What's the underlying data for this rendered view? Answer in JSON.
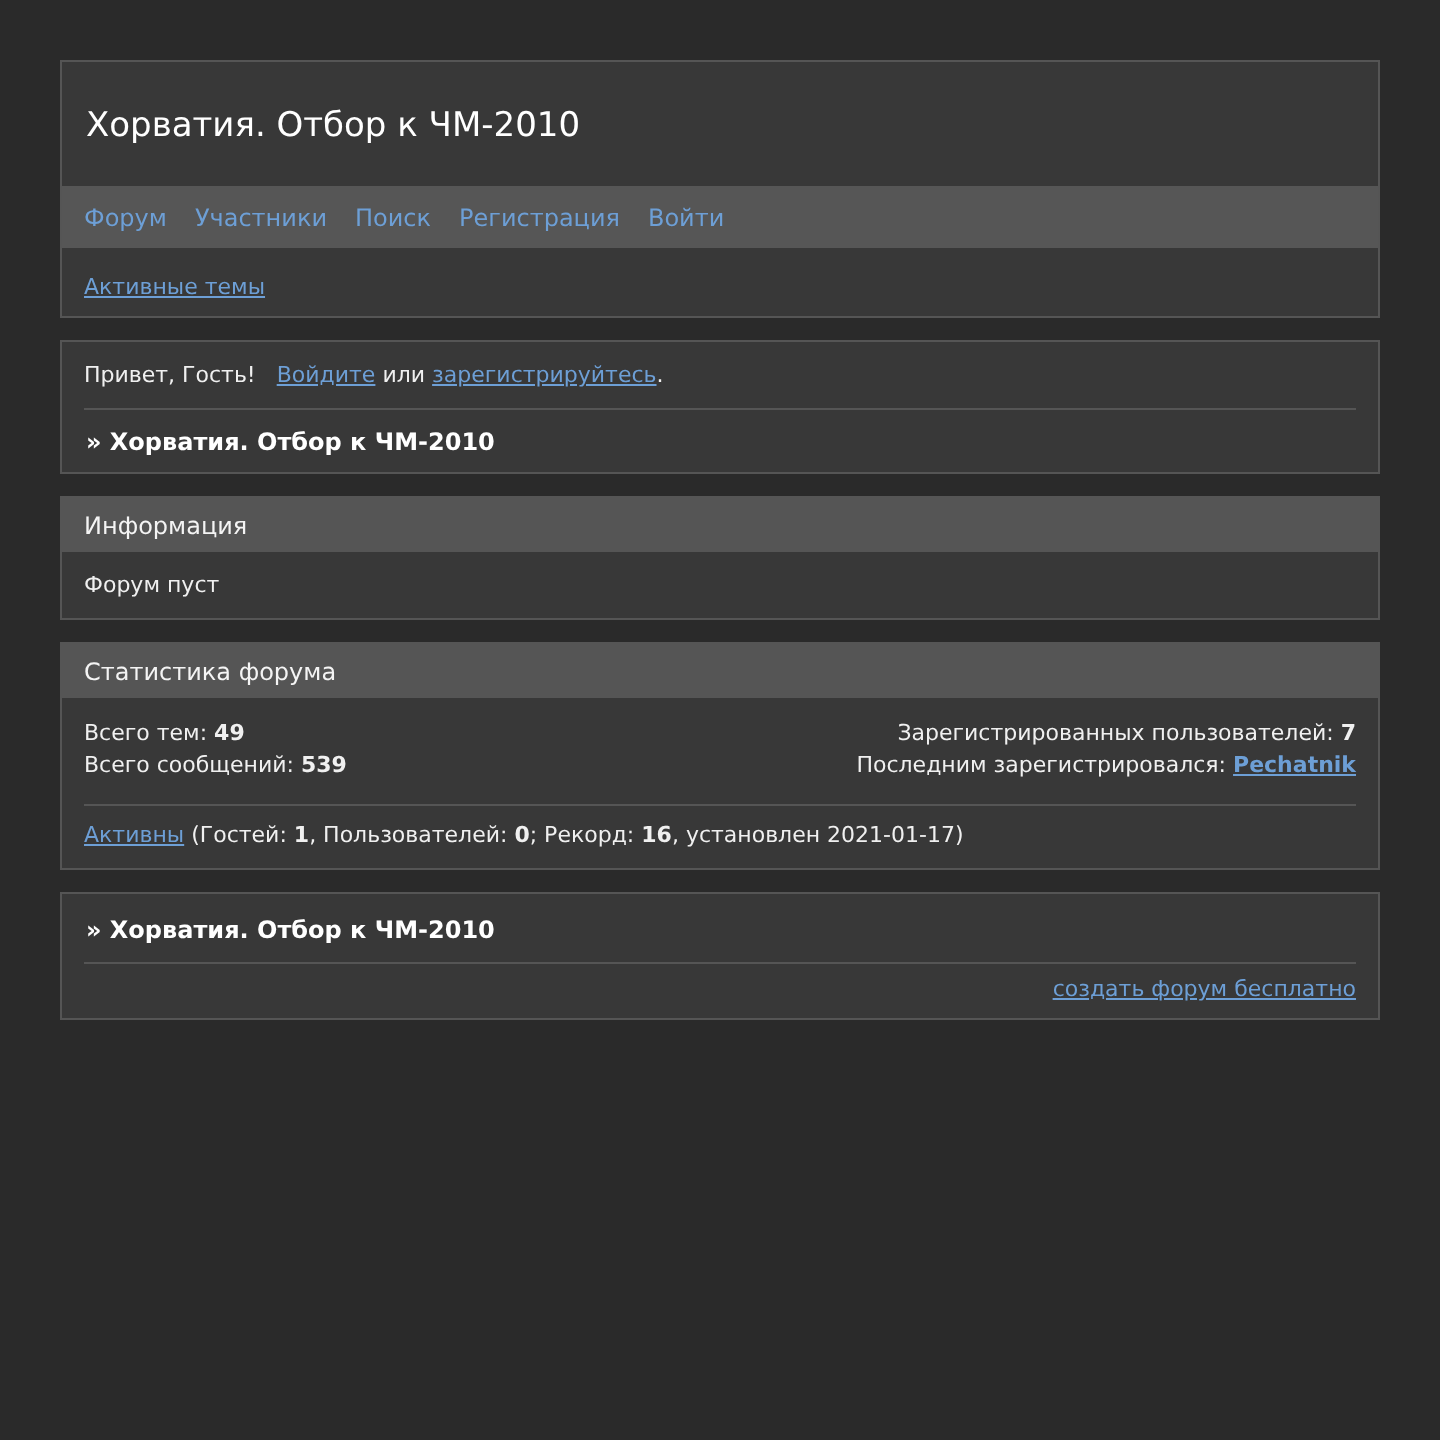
{
  "header": {
    "title": "Хорватия. Отбор к ЧМ-2010"
  },
  "nav": [
    {
      "label": "Форум"
    },
    {
      "label": "Участники"
    },
    {
      "label": "Поиск"
    },
    {
      "label": "Регистрация"
    },
    {
      "label": "Войти"
    }
  ],
  "subnav": [
    {
      "label": "Активные темы"
    }
  ],
  "greeting": {
    "text": "Привет, Гость!",
    "login_link": "Войдите",
    "or": "или",
    "register_link": "зарегистрируйтесь",
    "end": "."
  },
  "breadcrumb": "» Хорватия. Отбор к ЧМ-2010",
  "info": {
    "title": "Информация",
    "text": "Форум пуст"
  },
  "stats": {
    "title": "Статистика форума",
    "left": [
      "Всего тем: **49**",
      "Всего сообщений: **539**"
    ],
    "registered": "Зарегистрированных пользователей: **7**",
    "last_label": "Последним зарегистрировался:",
    "last_user": "Pechatnik",
    "online_link": "Активны",
    "online_text": "(Гостей: **1**, Пользователей: **0**; Рекорд: **16**, установлен 2021-01-17)"
  },
  "footer": {
    "breadcrumb": "» Хорватия. Отбор к ЧМ-2010",
    "link": "создать форум бесплатно"
  }
}
